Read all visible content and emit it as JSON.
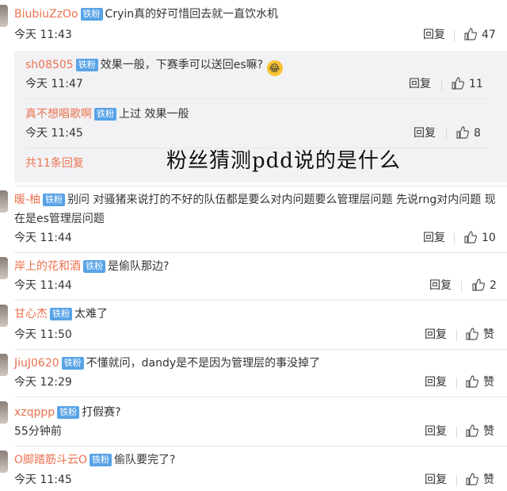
{
  "badge_label": "铁粉",
  "reply_label": "回复",
  "praise_label": "赞",
  "more_replies": "共11条回复",
  "overlay_text": "粉丝猜测pdd说的是什么",
  "comments": [
    {
      "user": "BiubiuZzOo",
      "text": "Cryin真的好可惜回去就一直饮水机",
      "time": "今天 11:43",
      "likes": "47"
    },
    {
      "user": "暖-柚",
      "text": "别问 对骚猪来说打的不好的队伍都是要么对内问题要么管理层问题 先说rng对内问题 现在是es管理层问题",
      "time": "今天 11:44",
      "likes": "10"
    },
    {
      "user": "岸上的花和酒",
      "text": "是偷队那边?",
      "time": "今天 11:44",
      "likes": "2"
    },
    {
      "user": "甘心杰",
      "text": "太难了",
      "time": "今天 11:50",
      "likes": ""
    },
    {
      "user": "JiuJ0620",
      "text": "不懂就问，dandy是不是因为管理层的事没掉了",
      "time": "今天 12:29",
      "likes": ""
    },
    {
      "user": "xzqppp",
      "text": "打假赛?",
      "time": "55分钟前",
      "likes": ""
    },
    {
      "user": "O脚踏筋斗云O",
      "text": "偷队要完了?",
      "time": "今天 11:45",
      "likes": ""
    }
  ],
  "subreplies": [
    {
      "user": "sh08505",
      "text": "效果一般，下赛季可以送回es嘛?",
      "emoji": "😂",
      "time": "今天 11:47",
      "likes": "11"
    },
    {
      "user": "真不想唱歌啊",
      "text": "上过 效果一般",
      "time": "今天 11:45",
      "likes": "8"
    }
  ]
}
